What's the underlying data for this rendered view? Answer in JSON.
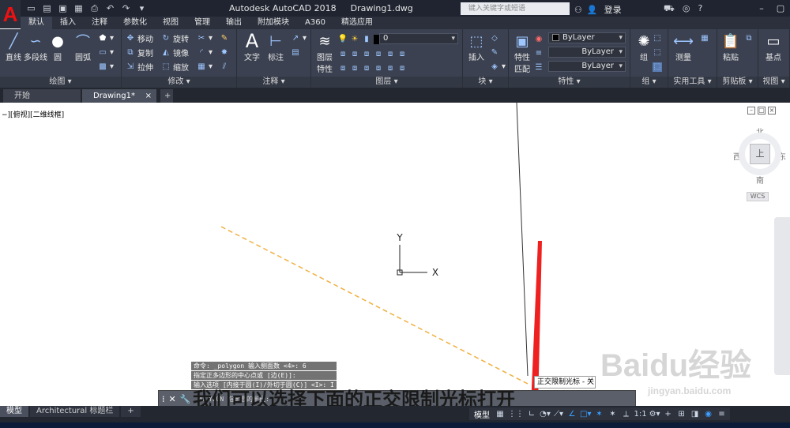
{
  "app": {
    "logo_letter": "A",
    "title": "Autodesk AutoCAD 2018",
    "filename": "Drawing1.dwg",
    "search_placeholder": "键入关键字或短语",
    "login": "登录"
  },
  "ribbon_tabs": [
    "默认",
    "插入",
    "注释",
    "参数化",
    "视图",
    "管理",
    "输出",
    "附加模块",
    "A360",
    "精选应用"
  ],
  "ribbon": {
    "draw": {
      "title": "绘图",
      "line": "直线",
      "polyline": "多段线",
      "circle": "圆",
      "arc": "圆弧"
    },
    "modify": {
      "title": "修改",
      "move": "移动",
      "rotate": "旋转",
      "copy": "复制",
      "mirror": "镜像",
      "stretch": "拉伸",
      "scale": "缩放"
    },
    "annotation": {
      "title": "注释",
      "text": "文字",
      "dimension": "标注"
    },
    "layers": {
      "title": "图层",
      "properties": "图层",
      "properties2": "特性",
      "current_layer": "0"
    },
    "block": {
      "title": "块",
      "insert": "插入"
    },
    "properties": {
      "title": "特性",
      "match": "特性",
      "match2": "匹配",
      "color": "ByLayer",
      "linetype": "ByLayer",
      "lineweight": "ByLayer"
    },
    "groups": {
      "title": "组",
      "group": "组"
    },
    "utilities": {
      "title": "实用工具",
      "measure": "测量"
    },
    "clipboard": {
      "title": "剪贴板",
      "paste": "粘贴"
    },
    "view": {
      "title": "视图",
      "base": "基点"
    }
  },
  "file_tabs": {
    "start": "开始",
    "drawing": "Drawing1*"
  },
  "canvas": {
    "viewport_label": "−][俯视][二维线框]",
    "viewcube": {
      "north": "北",
      "south": "南",
      "east": "东",
      "west": "西",
      "top": "上"
    },
    "wcs": "WCS",
    "ucs_x": "X",
    "ucs_y": "Y"
  },
  "command": {
    "history": [
      "命令:  _polygon 输入侧面数 <4>: 6",
      "指定正多边形的中心点或 [边(E)]:",
      "输入选项 [内接于圆(I)/外切于圆(C)] <I>: I"
    ],
    "prompt": "POLYGON 指定圆的半径:"
  },
  "tooltip": "正交限制光标 - 关",
  "subtitle": "我们可以选择下面的正交限制光标打开",
  "watermark": {
    "main": "Baidu经验",
    "sub": "jingyan.baidu.com"
  },
  "status": {
    "layout_tabs": [
      "模型",
      "Architectural 标题栏"
    ],
    "model": "模型",
    "scale": "1:1"
  },
  "colors": {
    "accent": "#3ea0ff",
    "dashed_line": "#f0b040",
    "arrow": "#ee2020"
  }
}
